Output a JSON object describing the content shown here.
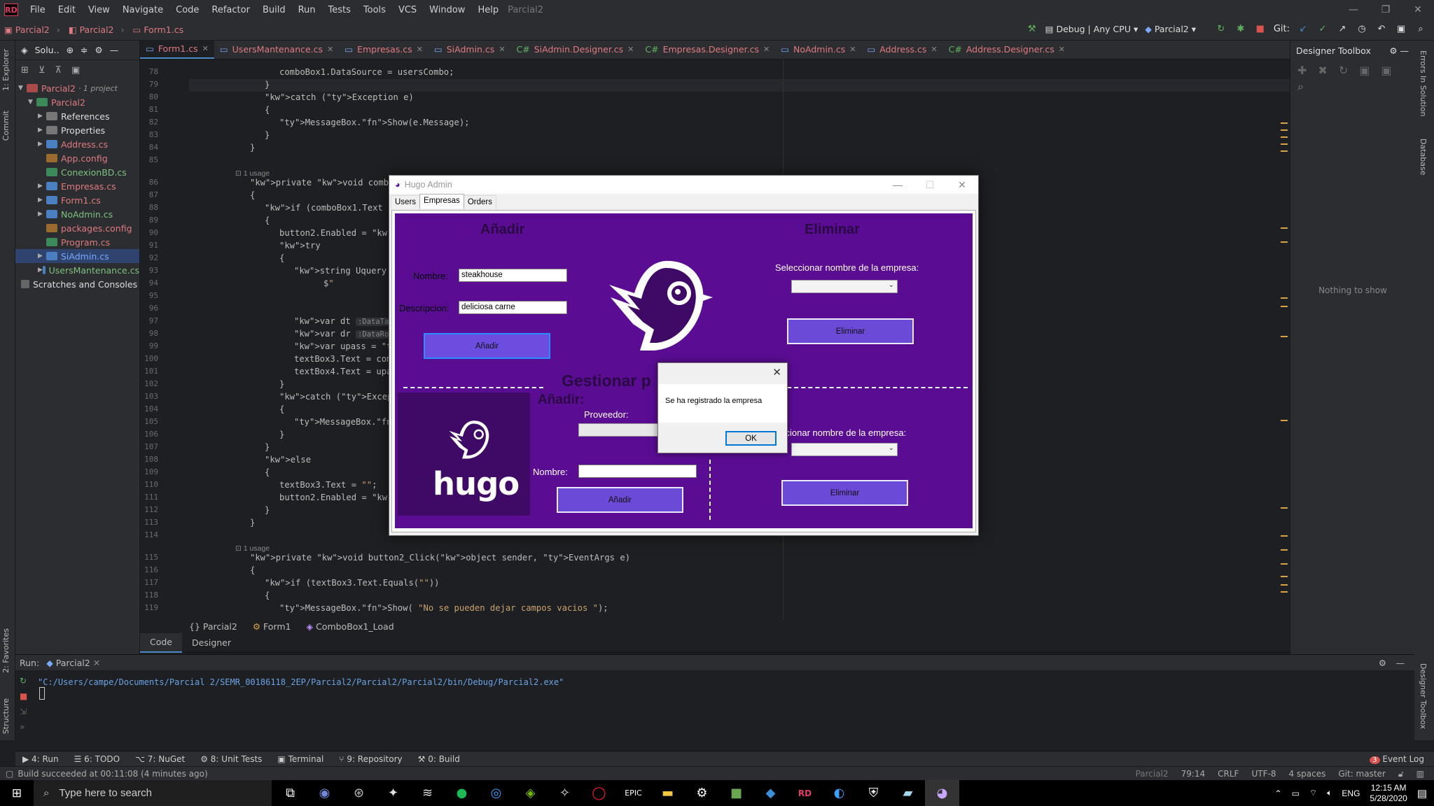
{
  "menubar": {
    "items": [
      "File",
      "Edit",
      "View",
      "Navigate",
      "Code",
      "Refactor",
      "Build",
      "Run",
      "Tests",
      "Tools",
      "VCS",
      "Window",
      "Help"
    ],
    "project": "Parcial2"
  },
  "navbar": {
    "breadcrumbs": [
      "Parcial2",
      "Parcial2",
      "Form1.cs"
    ],
    "config": "Debug | Any CPU",
    "run_target": "Parcial2",
    "git_label": "Git:"
  },
  "left_strip": {
    "explorer": "1: Explorer",
    "commit": "Commit",
    "favorites": "2: Favorites",
    "structure": "Structure"
  },
  "solution": {
    "header": "Solu..",
    "items": [
      {
        "label": "Parcial2",
        "suffix": "· 1 project",
        "color": "red"
      },
      {
        "label": "Parcial2",
        "color": "red"
      },
      {
        "label": "References",
        "color": "white"
      },
      {
        "label": "Properties",
        "color": "white"
      },
      {
        "label": "Address.cs",
        "color": "red"
      },
      {
        "label": "App.config",
        "color": "red"
      },
      {
        "label": "ConexionBD.cs",
        "color": "green"
      },
      {
        "label": "Empresas.cs",
        "color": "red"
      },
      {
        "label": "Form1.cs",
        "color": "red"
      },
      {
        "label": "NoAdmin.cs",
        "color": "green"
      },
      {
        "label": "packages.config",
        "color": "red"
      },
      {
        "label": "Program.cs",
        "color": "red"
      },
      {
        "label": "SiAdmin.cs",
        "color": "blue"
      },
      {
        "label": "UsersMantenance.cs",
        "color": "green"
      },
      {
        "label": "Scratches and Consoles",
        "color": "white"
      }
    ]
  },
  "tabs": [
    "Form1.cs",
    "UsersMantenance.cs",
    "Empresas.cs",
    "SiAdmin.cs",
    "SiAdmin.Designer.cs",
    "Empresas.Designer.cs",
    "NoAdmin.cs",
    "Address.cs",
    "Address.Designer.cs"
  ],
  "editor": {
    "lines": [
      {
        "n": "78",
        "t": "comboBox1.DataSource = usersCombo;"
      },
      {
        "n": "79",
        "t": "}"
      },
      {
        "n": "80",
        "t": "catch (Exception e)"
      },
      {
        "n": "81",
        "t": "{"
      },
      {
        "n": "82",
        "t": "MessageBox.Show(e.Message);"
      },
      {
        "n": "83",
        "t": "}"
      },
      {
        "n": "84",
        "t": "}"
      },
      {
        "n": "85",
        "t": ""
      },
      {
        "n": "86",
        "t": "private void comboBox1_Selected"
      },
      {
        "n": "87",
        "t": "{"
      },
      {
        "n": "88",
        "t": "if (comboBox1.Text != \"\")"
      },
      {
        "n": "89",
        "t": "{"
      },
      {
        "n": "90",
        "t": "button2.Enabled = true;"
      },
      {
        "n": "91",
        "t": "try"
      },
      {
        "n": "92",
        "t": "{"
      },
      {
        "n": "93",
        "t": "string Uquery = $\"S"
      },
      {
        "n": "94",
        "t": "$\""
      },
      {
        "n": "95",
        "t": ""
      },
      {
        "n": "96",
        "t": ""
      },
      {
        "n": "97",
        "t": "var dt"
      },
      {
        "n": "98",
        "t": "var dr"
      },
      {
        "n": "99",
        "t": "var upass = Convert"
      },
      {
        "n": "100",
        "t": "textBox3.Text = com"
      },
      {
        "n": "101",
        "t": "textBox4.Text = upa"
      },
      {
        "n": "102",
        "t": "}"
      },
      {
        "n": "103",
        "t": "catch (Exception ex)"
      },
      {
        "n": "104",
        "t": "{"
      },
      {
        "n": "105",
        "t": "MessageBox.Show(ex."
      },
      {
        "n": "106",
        "t": "}"
      },
      {
        "n": "107",
        "t": "}"
      },
      {
        "n": "108",
        "t": "else"
      },
      {
        "n": "109",
        "t": "{"
      },
      {
        "n": "110",
        "t": "textBox3.Text = \"\";"
      },
      {
        "n": "111",
        "t": "button2.Enabled = false"
      },
      {
        "n": "112",
        "t": "}"
      },
      {
        "n": "113",
        "t": "}"
      },
      {
        "n": "114",
        "t": ""
      },
      {
        "n": "115",
        "t": "private void button2_Click(object sender, EventArgs e)"
      },
      {
        "n": "116",
        "t": "{"
      },
      {
        "n": "117",
        "t": "if (textBox3.Text.Equals(\"\"))"
      },
      {
        "n": "118",
        "t": "{"
      },
      {
        "n": "119",
        "t": "MessageBox.Show( \"No se pueden dejar campos vacios \");"
      }
    ],
    "usage": "1 usage",
    "hint_datatable": ":DataTable",
    "hint_datarow": ":DataRow",
    "hint_text": "text:"
  },
  "footer_crumbs": [
    "Parcial2",
    "Form1",
    "ComboBox1_Load"
  ],
  "code_designer_tabs": [
    "Code",
    "Designer"
  ],
  "toolbox": {
    "title": "Designer Toolbox",
    "empty": "Nothing to show"
  },
  "right_strip": {
    "errors": "Errors In Solution",
    "database": "Database",
    "designer_toolbox": "Designer Toolbox"
  },
  "run": {
    "label": "Run:",
    "tab": "Parcial2",
    "command": "\"C:/Users/campe/Documents/Parcial 2/SEMR_00186118_2EP/Parcial2/Parcial2/Parcial2/bin/Debug/Parcial2.exe\""
  },
  "toolwindows": [
    "4: Run",
    "6: TODO",
    "7: NuGet",
    "8: Unit Tests",
    "Terminal",
    "9: Repository",
    "0: Build",
    "Event Log"
  ],
  "status": {
    "left": "Build succeeded at 00:11:08 (4 minutes ago)",
    "project": "Parcial2",
    "position": "79:14",
    "line_ending": "CRLF",
    "encoding": "UTF-8",
    "indent": "4 spaces",
    "git": "Git: master",
    "event_count": "3"
  },
  "taskbar": {
    "search_placeholder": "Type here to search",
    "lang": "ENG",
    "time": "12:15 AM",
    "date": "5/28/2020",
    "apps": [
      "task-view",
      "discord",
      "steam",
      "app-4",
      "app-5",
      "spotify",
      "app-7",
      "nvidia",
      "app-9",
      "opera",
      "epic-games",
      "file-explorer",
      "settings",
      "minecraft",
      "visual-studio",
      "rider",
      "app-16",
      "app-17",
      "app-18",
      "hugo-app"
    ]
  },
  "winform": {
    "title": "Hugo Admin",
    "tabs": [
      "Users",
      "Empresas",
      "Orders"
    ],
    "add_heading": "Añadir",
    "delete_heading": "Eliminar",
    "name_label": "Nombre:",
    "name_value": "steakhouse",
    "desc_label": "Descripcion:",
    "desc_value": "deliciosa carne",
    "add_button": "Añadir",
    "select_label": "Seleccionar nombre de la empresa:",
    "delete_button": "Eliminar",
    "manage_heading": "Gestionar p",
    "add2_heading": "Añadir:",
    "provider_label": "Proveedor:",
    "name2_label": "Nombre:",
    "add2_button": "Añadir",
    "select2_label": "ccionar nombre de la empresa:",
    "delete2_button": "Eliminar",
    "logo_text": "hugo",
    "accent": "#5a0d93"
  },
  "messagebox": {
    "text": "Se ha registrado la empresa",
    "ok": "OK"
  }
}
